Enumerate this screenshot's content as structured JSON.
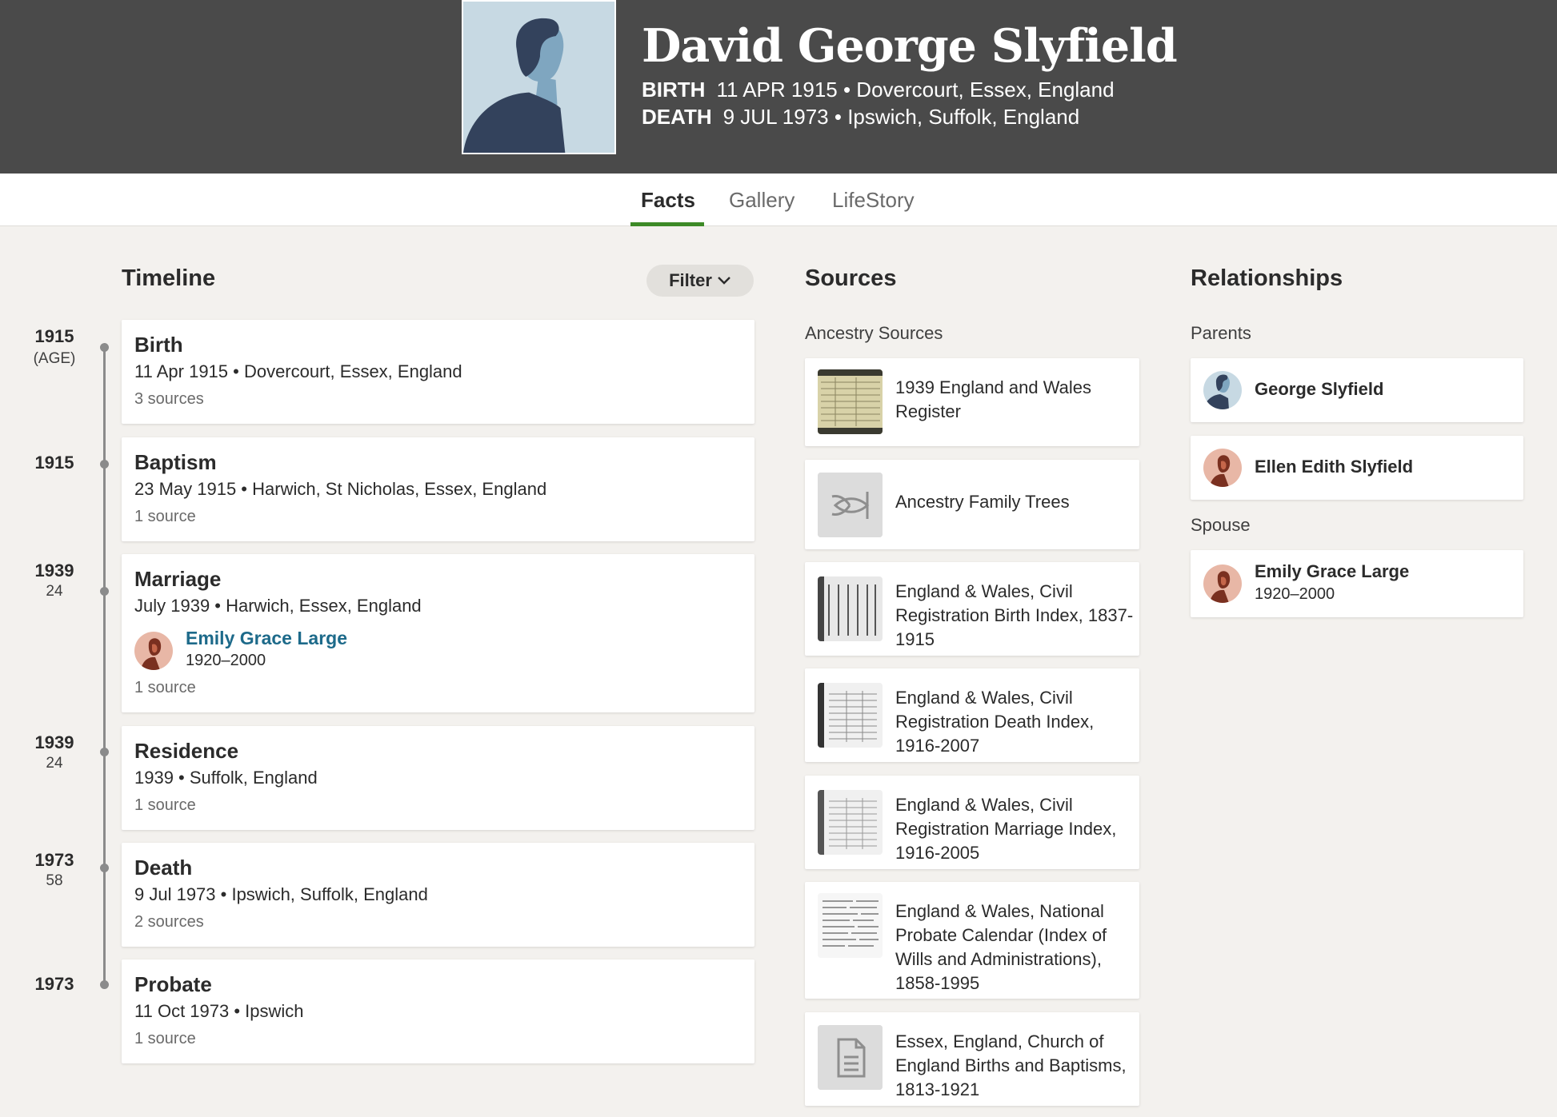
{
  "header": {
    "name": "David George Slyfield",
    "birth_label": "BIRTH",
    "birth_value": "11 APR 1915 • Dovercourt, Essex, England",
    "death_label": "DEATH",
    "death_value": "9 JUL 1973 • Ipswich, Suffolk, England"
  },
  "tabs": [
    {
      "label": "Facts",
      "active": true
    },
    {
      "label": "Gallery",
      "active": false
    },
    {
      "label": "LifeStory",
      "active": false
    }
  ],
  "timeline": {
    "heading": "Timeline",
    "filter_label": "Filter",
    "events": [
      {
        "year": "1915",
        "age": "(AGE)",
        "title": "Birth",
        "detail": "11 Apr 1915 • Dovercourt, Essex, England",
        "sources": "3 sources"
      },
      {
        "year": "1915",
        "age": "",
        "title": "Baptism",
        "detail": "23 May 1915 • Harwich, St Nicholas, Essex, England",
        "sources": "1 source"
      },
      {
        "year": "1939",
        "age": "24",
        "title": "Marriage",
        "detail": "July 1939 • Harwich, Essex, England",
        "spouse_name": "Emily Grace Large",
        "spouse_years": "1920–2000",
        "sources": "1 source"
      },
      {
        "year": "1939",
        "age": "24",
        "title": "Residence",
        "detail": "1939 • Suffolk, England",
        "sources": "1 source"
      },
      {
        "year": "1973",
        "age": "58",
        "title": "Death",
        "detail": "9 Jul 1973 • Ipswich, Suffolk, England",
        "sources": "2 sources"
      },
      {
        "year": "1973",
        "age": "",
        "title": "Probate",
        "detail": "11 Oct 1973 • Ipswich",
        "sources": "1 source"
      }
    ]
  },
  "sources": {
    "heading": "Sources",
    "subheading": "Ancestry Sources",
    "items": [
      {
        "title": "1939 England and Wales Register",
        "thumb": "register-image"
      },
      {
        "title": "Ancestry Family Trees",
        "thumb": "leaf-icon"
      },
      {
        "title": "England & Wales, Civil Registration Birth Index, 1837-1915",
        "thumb": "index-image"
      },
      {
        "title": "England & Wales, Civil Registration Death Index, 1916-2007",
        "thumb": "index-image"
      },
      {
        "title": "England & Wales, Civil Registration Marriage Index, 1916-2005",
        "thumb": "index-image"
      },
      {
        "title": "England & Wales, National Probate Calendar (Index of Wills and Administrations), 1858-1995",
        "thumb": "document-image"
      },
      {
        "title": "Essex, England, Church of England Births and Baptisms, 1813-1921",
        "thumb": "document-icon"
      }
    ]
  },
  "relationships": {
    "heading": "Relationships",
    "parents_label": "Parents",
    "parents": [
      {
        "name": "George Slyfield",
        "gender": "male"
      },
      {
        "name": "Ellen Edith Slyfield",
        "gender": "female"
      }
    ],
    "spouse_label": "Spouse",
    "spouse": {
      "name": "Emily Grace Large",
      "years": "1920–2000",
      "gender": "female"
    }
  },
  "colors": {
    "header_bg": "#4a4a4a",
    "tab_accent": "#3d8a27",
    "link": "#1d6a8a",
    "female_avatar": "#e8b7a6",
    "male_avatar": "#c7d9e3"
  }
}
